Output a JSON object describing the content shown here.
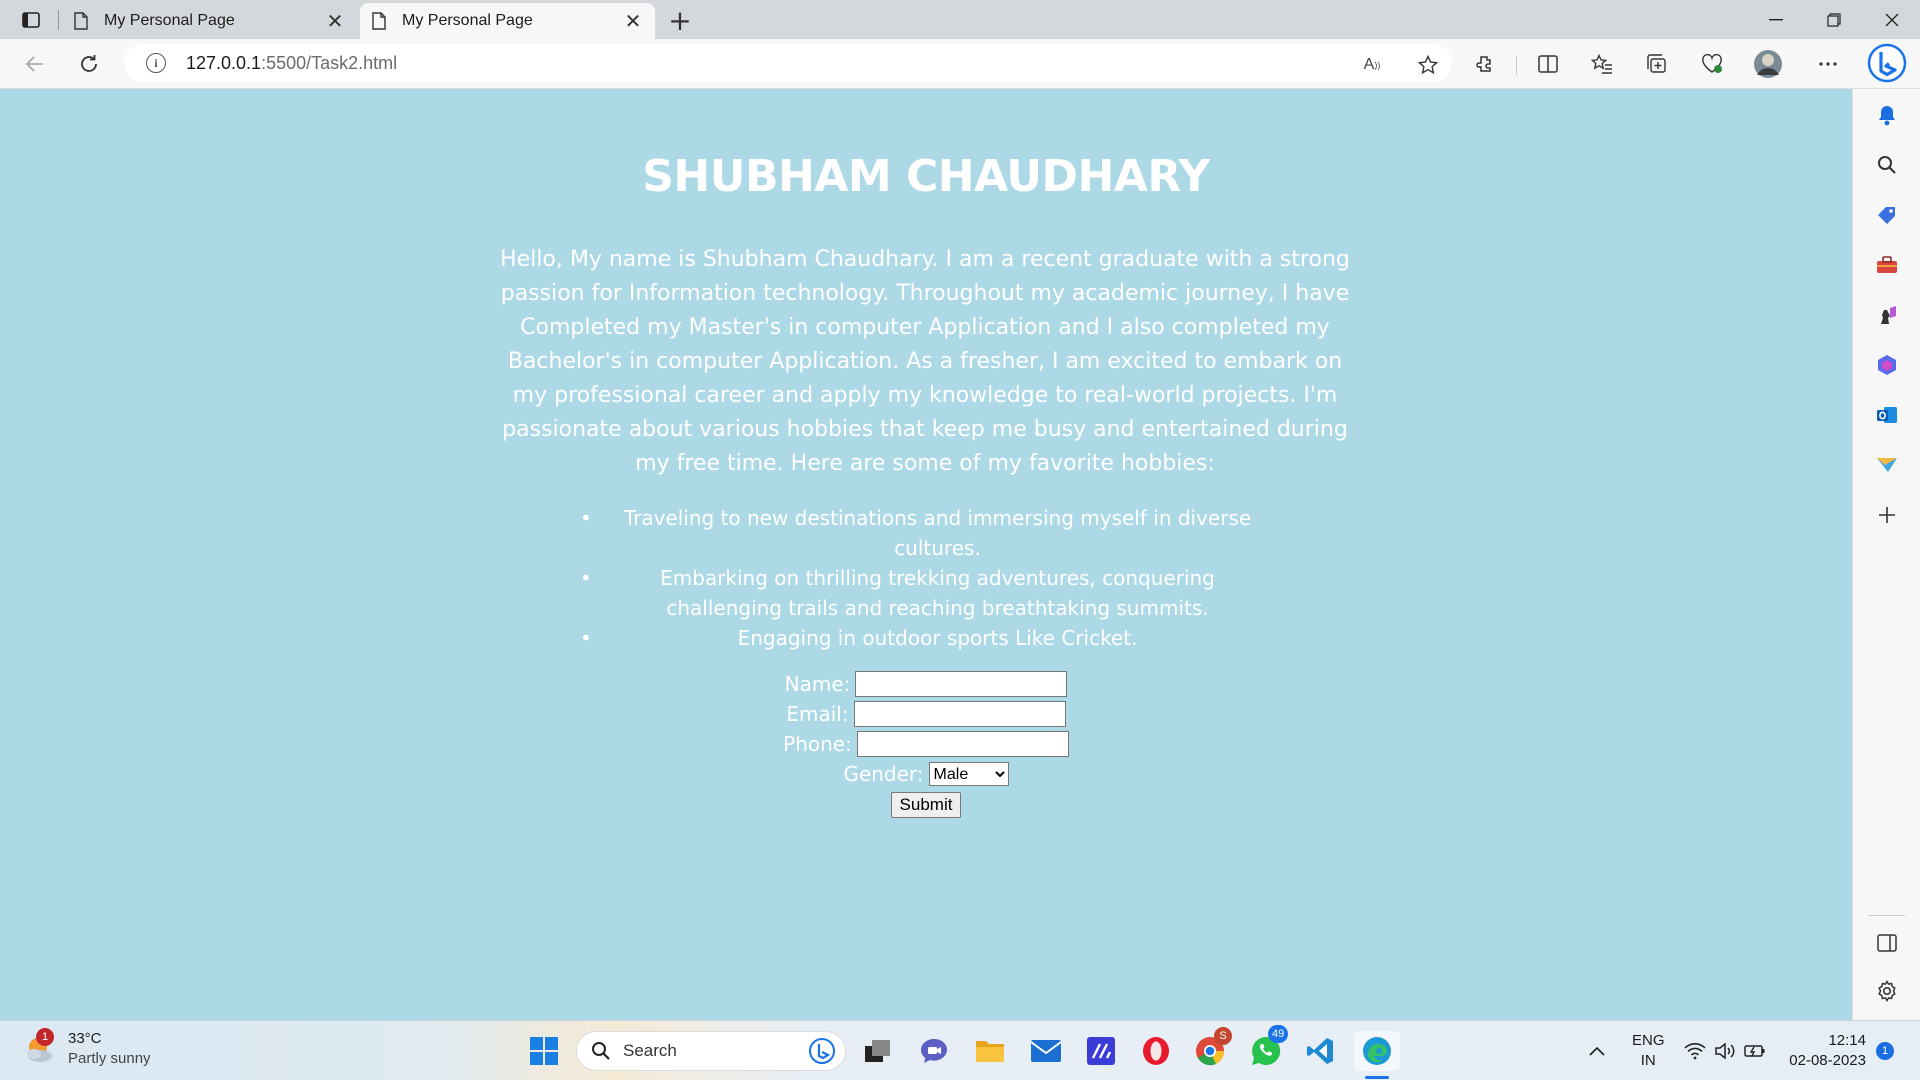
{
  "browser": {
    "tabs": [
      {
        "title": "My Personal Page",
        "active": false
      },
      {
        "title": "My Personal Page",
        "active": true
      }
    ],
    "url_host": "127.0.0.1",
    "url_rest": ":5500/Task2.html"
  },
  "page": {
    "title": "SHUBHAM CHAUDHARY",
    "intro": "Hello, My name is Shubham Chaudhary. I am a recent graduate with a strong passion for Information technology. Throughout my academic journey, I have Completed my Master's in computer Application and I also completed my Bachelor's in computer Application. As a fresher, I am excited to embark on my professional career and apply my knowledge to real-world projects. I'm passionate about various hobbies that keep me busy and entertained during my free time. Here are some of my favorite hobbies:",
    "hobbies": [
      "Traveling to new destinations and immersing myself in diverse cultures.",
      "Embarking on thrilling trekking adventures, conquering challenging trails and reaching breathtaking summits.",
      "Engaging in outdoor sports Like Cricket."
    ],
    "form": {
      "name_label": "Name:",
      "email_label": "Email:",
      "phone_label": "Phone:",
      "gender_label": "Gender:",
      "gender_selected": "Male",
      "submit_label": "Submit"
    },
    "background_color": "#add8e6"
  },
  "taskbar": {
    "weather_temp": "33°C",
    "weather_desc": "Partly sunny",
    "weather_badge": "1",
    "search_label": "Search",
    "chrome_badge": "S",
    "whatsapp_badge": "49",
    "lang_top": "ENG",
    "lang_bottom": "IN",
    "time": "12:14",
    "date": "02-08-2023",
    "notification_count": "1"
  }
}
